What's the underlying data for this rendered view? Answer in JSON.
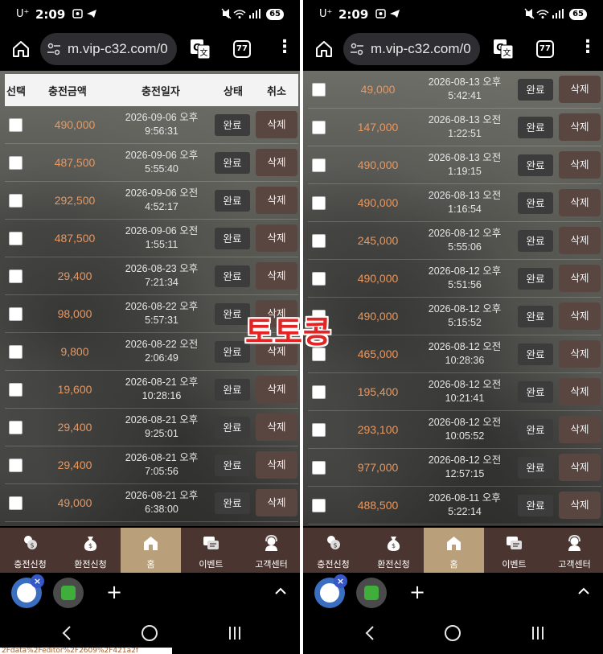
{
  "status_bar": {
    "carrier": "U⁺",
    "time": "2:09",
    "battery": "65"
  },
  "url_bar": {
    "url": "m.vip-c32.com/0",
    "tab_count": "77"
  },
  "table_header": {
    "select": "선택",
    "amount": "충전금액",
    "date": "충전일자",
    "status": "상태",
    "cancel": "취소"
  },
  "left_rows": [
    {
      "amount": "490,000",
      "date_line1": "2026-09-06 오후",
      "date_line2": "9:56:31",
      "status": "완료",
      "action": "삭제"
    },
    {
      "amount": "487,500",
      "date_line1": "2026-09-06 오후",
      "date_line2": "5:55:40",
      "status": "완료",
      "action": "삭제"
    },
    {
      "amount": "292,500",
      "date_line1": "2026-09-06 오전",
      "date_line2": "4:52:17",
      "status": "완료",
      "action": "삭제"
    },
    {
      "amount": "487,500",
      "date_line1": "2026-09-06 오전",
      "date_line2": "1:55:11",
      "status": "완료",
      "action": "삭제"
    },
    {
      "amount": "29,400",
      "date_line1": "2026-08-23 오후",
      "date_line2": "7:21:34",
      "status": "완료",
      "action": "삭제"
    },
    {
      "amount": "98,000",
      "date_line1": "2026-08-22 오후",
      "date_line2": "5:57:31",
      "status": "완료",
      "action": "삭제"
    },
    {
      "amount": "9,800",
      "date_line1": "2026-08-22 오전",
      "date_line2": "2:06:49",
      "status": "완료",
      "action": "삭제"
    },
    {
      "amount": "19,600",
      "date_line1": "2026-08-21 오후",
      "date_line2": "10:28:16",
      "status": "완료",
      "action": "삭제"
    },
    {
      "amount": "29,400",
      "date_line1": "2026-08-21 오후",
      "date_line2": "9:25:01",
      "status": "완료",
      "action": "삭제"
    },
    {
      "amount": "29,400",
      "date_line1": "2026-08-21 오후",
      "date_line2": "7:05:56",
      "status": "완료",
      "action": "삭제"
    },
    {
      "amount": "49,000",
      "date_line1": "2026-08-21 오후",
      "date_line2": "6:38:00",
      "status": "완료",
      "action": "삭제"
    }
  ],
  "right_rows": [
    {
      "amount": "49,000",
      "date_line1": "2026-08-13 오후",
      "date_line2": "5:42:41",
      "status": "완료",
      "action": "삭제"
    },
    {
      "amount": "147,000",
      "date_line1": "2026-08-13 오전",
      "date_line2": "1:22:51",
      "status": "완료",
      "action": "삭제"
    },
    {
      "amount": "490,000",
      "date_line1": "2026-08-13 오전",
      "date_line2": "1:19:15",
      "status": "완료",
      "action": "삭제"
    },
    {
      "amount": "490,000",
      "date_line1": "2026-08-13 오전",
      "date_line2": "1:16:54",
      "status": "완료",
      "action": "삭제"
    },
    {
      "amount": "245,000",
      "date_line1": "2026-08-12 오후",
      "date_line2": "5:55:06",
      "status": "완료",
      "action": "삭제"
    },
    {
      "amount": "490,000",
      "date_line1": "2026-08-12 오후",
      "date_line2": "5:51:56",
      "status": "완료",
      "action": "삭제"
    },
    {
      "amount": "490,000",
      "date_line1": "2026-08-12 오후",
      "date_line2": "5:15:52",
      "status": "완료",
      "action": "삭제"
    },
    {
      "amount": "465,000",
      "date_line1": "2026-08-12 오전",
      "date_line2": "10:28:36",
      "status": "완료",
      "action": "삭제"
    },
    {
      "amount": "195,400",
      "date_line1": "2026-08-12 오전",
      "date_line2": "10:21:41",
      "status": "완료",
      "action": "삭제"
    },
    {
      "amount": "293,100",
      "date_line1": "2026-08-12 오전",
      "date_line2": "10:05:52",
      "status": "완료",
      "action": "삭제"
    },
    {
      "amount": "977,000",
      "date_line1": "2026-08-12 오전",
      "date_line2": "12:57:15",
      "status": "완료",
      "action": "삭제"
    },
    {
      "amount": "488,500",
      "date_line1": "2026-08-11 오후",
      "date_line2": "5:22:14",
      "status": "완료",
      "action": "삭제"
    }
  ],
  "bottom_nav": [
    {
      "label": "충전신청",
      "icon": "coins-icon"
    },
    {
      "label": "환전신청",
      "icon": "money-bag-icon"
    },
    {
      "label": "홈",
      "icon": "home-icon",
      "active": true
    },
    {
      "label": "이벤트",
      "icon": "chat-icon"
    },
    {
      "label": "고객센터",
      "icon": "support-agent-icon"
    }
  ],
  "watermark": "토토콩",
  "footer_text": "2Fdata%2Feditor%2F2609%2F421a2f",
  "colors": {
    "amount": "#e89860",
    "nav_bg": "#4a3530",
    "nav_active": "#b9a07a",
    "delete_btn": "#5a4640",
    "watermark": "#e32424"
  }
}
